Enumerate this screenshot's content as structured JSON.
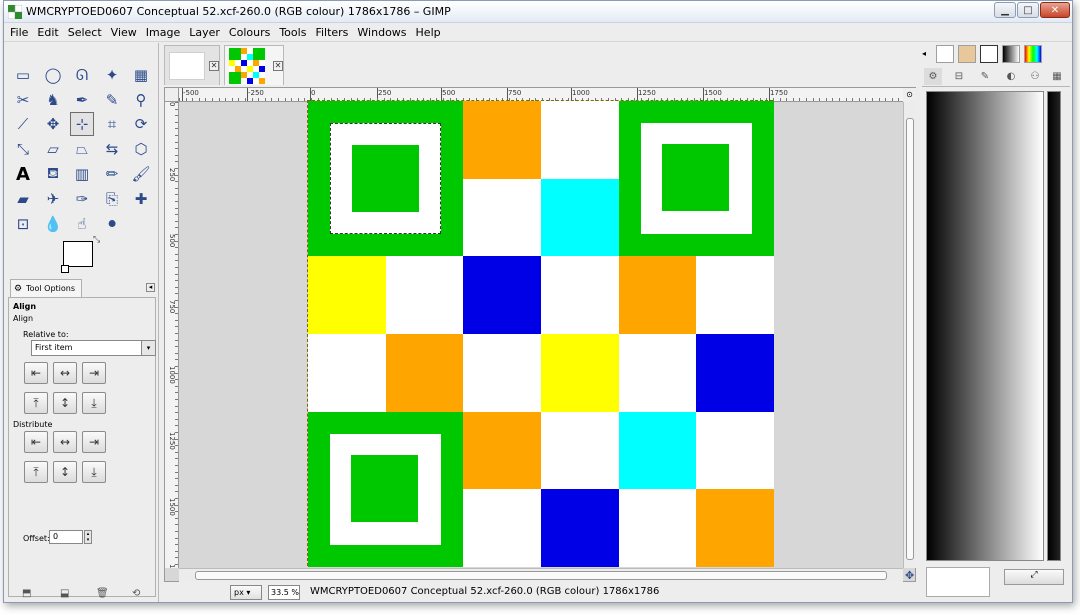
{
  "window": {
    "title": "WMCRYPTOED0607 Conceptual 52.xcf-260.0 (RGB colour) 1786x1786 – GIMP",
    "min_glyph": "▁",
    "max_glyph": "□",
    "close_glyph": "✕"
  },
  "menu": [
    "File",
    "Edit",
    "Select",
    "View",
    "Image",
    "Layer",
    "Colours",
    "Tools",
    "Filters",
    "Windows",
    "Help"
  ],
  "tools": [
    {
      "name": "rect-select-tool-icon",
      "glyph": "▭"
    },
    {
      "name": "ellipse-select-tool-icon",
      "glyph": "◯"
    },
    {
      "name": "free-select-tool-icon",
      "glyph": "ᘏ"
    },
    {
      "name": "fuzzy-select-tool-icon",
      "glyph": "✦"
    },
    {
      "name": "by-color-select-tool-icon",
      "glyph": "▦"
    },
    {
      "name": "scissors-select-tool-icon",
      "glyph": "✂"
    },
    {
      "name": "foreground-select-tool-icon",
      "glyph": "♞"
    },
    {
      "name": "paths-tool-icon",
      "glyph": "✒"
    },
    {
      "name": "color-picker-tool-icon",
      "glyph": "✎"
    },
    {
      "name": "zoom-tool-icon",
      "glyph": "⚲"
    },
    {
      "name": "measure-tool-icon",
      "glyph": "⟋"
    },
    {
      "name": "move-tool-icon",
      "glyph": "✥"
    },
    {
      "name": "align-tool-icon",
      "glyph": "⊹"
    },
    {
      "name": "crop-tool-icon",
      "glyph": "⌗"
    },
    {
      "name": "rotate-tool-icon",
      "glyph": "⟳"
    },
    {
      "name": "scale-tool-icon",
      "glyph": "⤡"
    },
    {
      "name": "shear-tool-icon",
      "glyph": "▱"
    },
    {
      "name": "perspective-tool-icon",
      "glyph": "⏢"
    },
    {
      "name": "flip-tool-icon",
      "glyph": "⇆"
    },
    {
      "name": "cage-transform-tool-icon",
      "glyph": "⬡"
    },
    {
      "name": "text-tool-icon",
      "glyph": "A"
    },
    {
      "name": "bucket-fill-tool-icon",
      "glyph": "⛾"
    },
    {
      "name": "blend-tool-icon",
      "glyph": "▥"
    },
    {
      "name": "pencil-tool-icon",
      "glyph": "✏"
    },
    {
      "name": "paintbrush-tool-icon",
      "glyph": "🖌"
    },
    {
      "name": "eraser-tool-icon",
      "glyph": "▰"
    },
    {
      "name": "airbrush-tool-icon",
      "glyph": "✈"
    },
    {
      "name": "ink-tool-icon",
      "glyph": "✑"
    },
    {
      "name": "clone-tool-icon",
      "glyph": "⎘"
    },
    {
      "name": "heal-tool-icon",
      "glyph": "✚"
    },
    {
      "name": "perspective-clone-tool-icon",
      "glyph": "⊡"
    },
    {
      "name": "blur-tool-icon",
      "glyph": "💧"
    },
    {
      "name": "smudge-tool-icon",
      "glyph": "☝"
    },
    {
      "name": "dodge-burn-tool-icon",
      "glyph": "⚫"
    }
  ],
  "tool_options": {
    "tab_label": "Tool Options",
    "tab_icon": "⚙",
    "close_glyph": "◂",
    "title": "Align",
    "subtitle": "Align",
    "relative_label": "Relative to:",
    "relative_value": "First item",
    "dropdown_glyph": "▾",
    "distribute_label": "Distribute",
    "offset_label": "Offset:",
    "offset_value": "0",
    "spin_up": "▴",
    "spin_down": "▾",
    "align_buttons": [
      "⇤",
      "↔",
      "⇥",
      "⤒",
      "↕",
      "⤓"
    ],
    "distribute_buttons": [
      "⇤",
      "↔",
      "⇥",
      "⤒",
      "↕",
      "⤓"
    ]
  },
  "tabs": [
    {
      "close_glyph": "✕"
    },
    {
      "close_glyph": "✕"
    }
  ],
  "rulers": {
    "h_labels": [
      "-500",
      "-250",
      "0",
      "250",
      "500",
      "750",
      "1000",
      "1250",
      "1500",
      "1750"
    ],
    "v_labels": [
      "0",
      "250",
      "500",
      "750",
      "1000",
      "1250",
      "1500",
      "1750"
    ],
    "nav_glyph": "⊙"
  },
  "image_grid": [
    [
      "#00c800",
      "#00c800",
      "#ffa500",
      "#ffffff",
      "#00c800",
      "#00c800"
    ],
    [
      "#00c800",
      "#00c800",
      "#ffffff",
      "#00ffff",
      "#00c800",
      "#00c800"
    ],
    [
      "#ffff00",
      "#ffffff",
      "#0000e6",
      "#ffffff",
      "#ffa500",
      "#ffffff"
    ],
    [
      "#ffffff",
      "#ffa500",
      "#ffffff",
      "#ffff00",
      "#ffffff",
      "#0000e6"
    ],
    [
      "#00c800",
      "#00c800",
      "#ffa500",
      "#ffffff",
      "#00ffff",
      "#ffffff"
    ],
    [
      "#00c800",
      "#00c800",
      "#ffffff",
      "#0000e6",
      "#ffffff",
      "#ffa500"
    ]
  ],
  "statusbar": {
    "unit": "px",
    "unit_glyph": "▾",
    "zoom": "33.5 %",
    "zoom_glyph": "▾",
    "text": "WMCRYPTOED0607 Conceptual 52.xcf-260.0 (RGB colour) 1786x1786"
  },
  "dock": {
    "tab_glyphs": [
      "⚙",
      "⊟",
      "✎",
      "◐",
      "⚇",
      "▦"
    ],
    "bottom_btn_glyph": "⤢"
  },
  "toolbox_bottom": [
    "⬒",
    "⬓",
    "🗑",
    "⟲"
  ]
}
